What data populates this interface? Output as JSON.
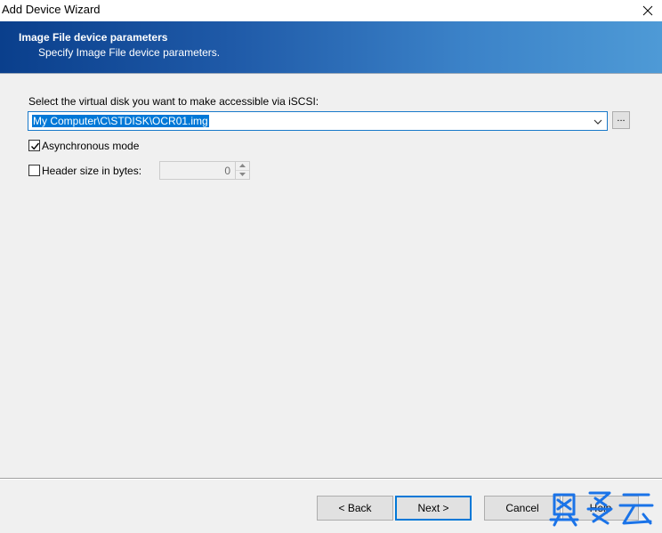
{
  "window": {
    "title": "Add Device Wizard"
  },
  "banner": {
    "title": "Image File device parameters",
    "subtitle": "Specify Image File device parameters."
  },
  "form": {
    "disk_label": "Select the virtual disk you want to make accessible via iSCSI:",
    "disk_path": "My Computer\\C\\STDISK\\OCR01.img",
    "browse_label": "...",
    "async_mode_label": "Asynchronous mode",
    "async_mode_checked": true,
    "header_size_label": "Header size in bytes:",
    "header_size_checked": false,
    "header_size_value": "0"
  },
  "buttons": {
    "back": "< Back",
    "next": "Next >",
    "cancel": "Cancel",
    "help": "Help"
  },
  "icons": {
    "close": "close-icon",
    "dropdown": "chevron-down-icon",
    "check": "checkmark-icon",
    "spin_up": "spin-up-icon",
    "spin_down": "spin-down-icon"
  },
  "colors": {
    "banner_dark": "#0a3f8c",
    "banner_light": "#4e9ad6",
    "selection": "#0078d7",
    "focus_border": "#0078d7",
    "watermark": "#1a73e8"
  }
}
